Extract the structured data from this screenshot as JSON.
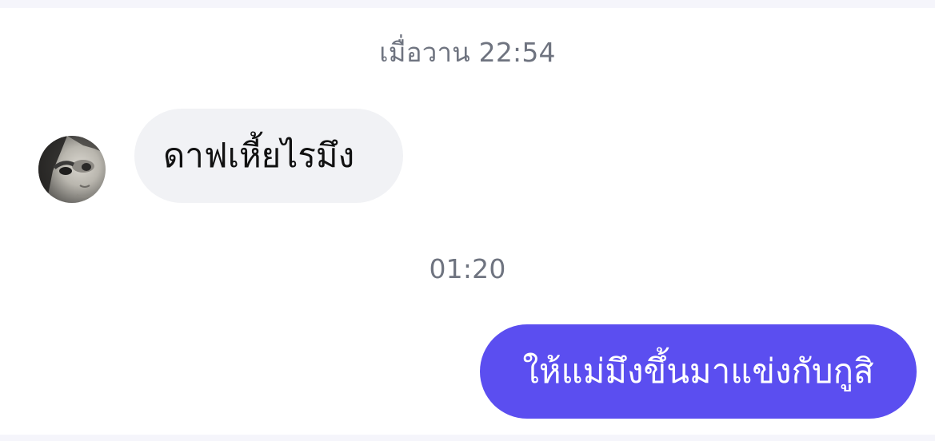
{
  "chat": {
    "messages": [
      {
        "type": "timestamp",
        "text": "เมื่อวาน 22:54"
      },
      {
        "type": "incoming",
        "text": "ดาฟเหี้ยไรมึง",
        "avatar_icon": "user-avatar-icon"
      },
      {
        "type": "timestamp",
        "text": "01:20"
      },
      {
        "type": "outgoing",
        "text": "ให้แม่มึงขึ้นมาแข่งกับกูสิ"
      }
    ]
  },
  "colors": {
    "outgoing_bubble": "#5b4ef0",
    "incoming_bubble": "#f1f2f5",
    "timestamp_text": "#6f7480",
    "background": "#ffffff"
  }
}
